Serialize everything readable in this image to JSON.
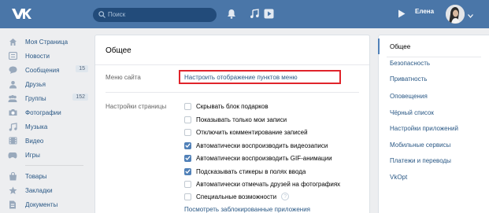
{
  "header": {
    "logo": "VK",
    "search_placeholder": "Поиск",
    "user_name": "Елена",
    "icons": [
      "vk-logo-icon",
      "search-icon",
      "bell-icon",
      "music-icon",
      "play-icon",
      "avatar"
    ]
  },
  "sidebar": {
    "items": [
      {
        "label": "Моя Страница",
        "icon": "home-icon"
      },
      {
        "label": "Новости",
        "icon": "news-icon"
      },
      {
        "label": "Сообщения",
        "icon": "messages-icon",
        "badge": "15"
      },
      {
        "label": "Друзья",
        "icon": "friends-icon"
      },
      {
        "label": "Группы",
        "icon": "groups-icon",
        "badge": "152"
      },
      {
        "label": "Фотографии",
        "icon": "camera-icon"
      },
      {
        "label": "Музыка",
        "icon": "music-icon"
      },
      {
        "label": "Видео",
        "icon": "video-icon"
      },
      {
        "label": "Игры",
        "icon": "games-icon"
      },
      {
        "label": "Товары",
        "icon": "goods-icon"
      },
      {
        "label": "Закладки",
        "icon": "star-icon"
      },
      {
        "label": "Документы",
        "icon": "documents-icon"
      }
    ]
  },
  "main": {
    "title": "Общее",
    "menu_label": "Меню сайта",
    "menu_link": "Настроить отображение пунктов меню",
    "page_settings_label": "Настройки страницы",
    "checkboxes": [
      {
        "label": "Скрывать блок подарков",
        "checked": false
      },
      {
        "label": "Показывать только мои записи",
        "checked": false
      },
      {
        "label": "Отключить комментирование записей",
        "checked": false
      },
      {
        "label": "Автоматически воспроизводить видеозаписи",
        "checked": true
      },
      {
        "label": "Автоматически воспроизводить GIF-анимации",
        "checked": true
      },
      {
        "label": "Подсказывать стикеры в полях ввода",
        "checked": true
      },
      {
        "label": "Автоматически отмечать друзей на фотографиях",
        "checked": false
      },
      {
        "label": "Специальные возможности",
        "checked": false,
        "help": "?"
      }
    ],
    "blocked_link": "Посмотреть заблокированные приложения"
  },
  "right_menu": {
    "items": [
      {
        "label": "Общее",
        "active": true
      },
      {
        "label": "Безопасность"
      },
      {
        "label": "Приватность"
      },
      {
        "label": "Оповещения"
      },
      {
        "label": "Чёрный список"
      },
      {
        "label": "Настройки приложений"
      },
      {
        "label": "Мобильные сервисы"
      },
      {
        "label": "Платежи и переводы"
      },
      {
        "label": "VkOpt"
      }
    ]
  },
  "colors": {
    "header": "#4a76a8",
    "link": "#2a5885",
    "checkbox_on": "#5181b8",
    "highlight_box": "#e0242b"
  }
}
